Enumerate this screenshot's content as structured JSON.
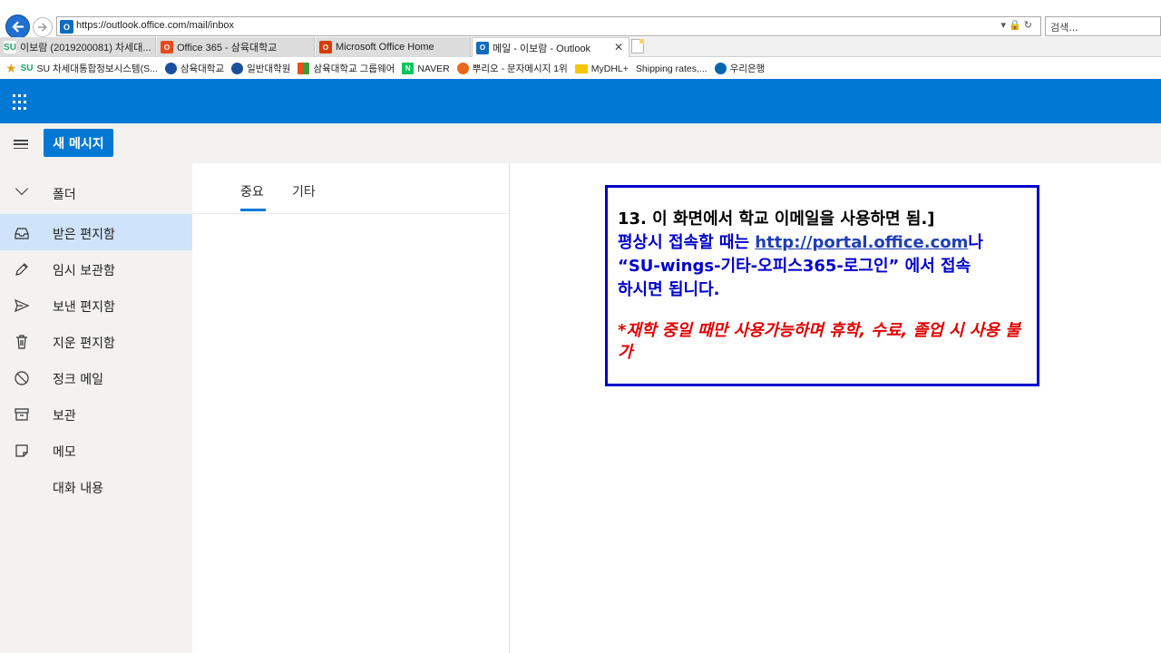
{
  "browser": {
    "url": "https://outlook.office.com/mail/inbox",
    "search_placeholder": "검색...",
    "tabs": [
      {
        "label": "이보람 (2019200081) 차세대...",
        "icon_text": "SU",
        "icon_color": "#1ea36a"
      },
      {
        "label": "Office 365 - 삼육대학교",
        "icon_text": "O",
        "icon_color": "#e64a19"
      },
      {
        "label": "Microsoft Office Home",
        "icon_text": "O",
        "icon_color": "#d83b01"
      },
      {
        "label": "메일 - 이보람 - Outlook",
        "icon_text": "O",
        "icon_color": "#0f6cbd"
      }
    ],
    "favorites": [
      {
        "label": "SU 차세대통합정보시스템(S...",
        "icon_color": "#1ea36a"
      },
      {
        "label": "삼육대학교",
        "icon_color": "#1b4f9c"
      },
      {
        "label": "일반대학원",
        "icon_color": "#1b4f9c"
      },
      {
        "label": "삼육대학교 그룹웨어",
        "icon_color": "#e94e1b"
      },
      {
        "label": "NAVER",
        "icon_color": "#03c75a"
      },
      {
        "label": "뿌리오 - 문자메시지 1위",
        "icon_color": "#e8671b"
      },
      {
        "label": "MyDHL+",
        "icon_color": "#f7c600"
      },
      {
        "label": "Shipping rates,...",
        "icon_color": "#ffffff"
      },
      {
        "label": "우리은행",
        "icon_color": "#0067ac"
      }
    ]
  },
  "outlook": {
    "brand_color": "#0078d4",
    "new_message_label": "새 메시지",
    "folder_header": "폴더",
    "folders": [
      {
        "label": "받은 편지함",
        "icon": "inbox-icon"
      },
      {
        "label": "임시 보관함",
        "icon": "pencil-icon"
      },
      {
        "label": "보낸 편지함",
        "icon": "send-icon"
      },
      {
        "label": "지운 편지함",
        "icon": "trash-icon"
      },
      {
        "label": "정크 메일",
        "icon": "block-icon"
      },
      {
        "label": "보관",
        "icon": "archive-icon"
      },
      {
        "label": "메모",
        "icon": "note-icon"
      },
      {
        "label": "대화 내용",
        "icon": ""
      }
    ],
    "list_tabs": [
      {
        "label": "중요"
      },
      {
        "label": "기타"
      }
    ]
  },
  "note": {
    "line1": "13. 이 화면에서 학교 이메일을 사용하면 됨.]",
    "line2_prefix": "평상시 접속할 때는 ",
    "line2_link": "http://portal.office.com",
    "line2_suffix": "나",
    "line3": "“SU-wings-기타-오피스365-로그인”  에서 접속",
    "line4": "하시면 됩니다.",
    "warning": "*재학 중일 때만 사용가능하며 휴학, 수료, 졸업 시 사용 불가"
  }
}
